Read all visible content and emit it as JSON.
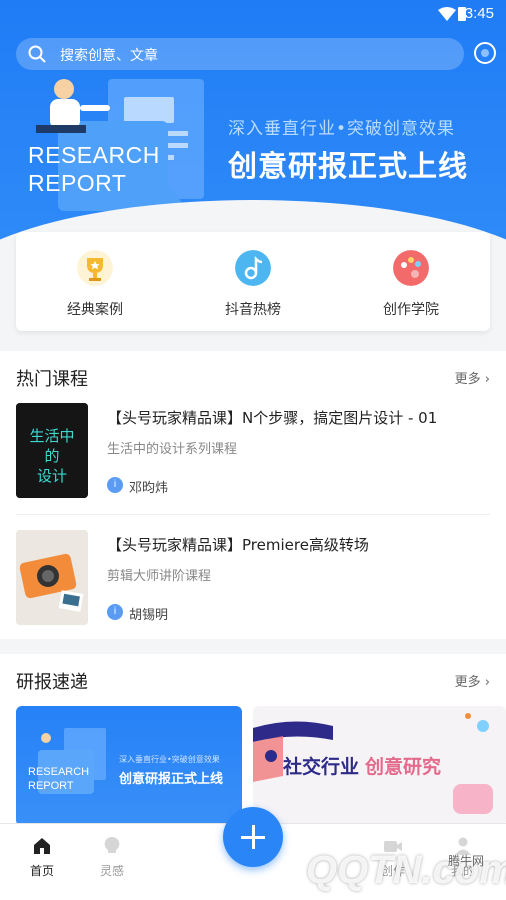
{
  "status": {
    "time": "3:45"
  },
  "search": {
    "placeholder": "搜索创意、文章"
  },
  "banner": {
    "eng_line1": "RESEARCH",
    "eng_line2": "REPORT",
    "subtitle": "深入垂直行业•突破创意效果",
    "title": "创意研报正式上线"
  },
  "quick_entries": [
    {
      "label": "经典案例",
      "icon": "trophy-icon",
      "color": "#f5b82e"
    },
    {
      "label": "抖音热榜",
      "icon": "music-note-icon",
      "color": "#4db6f0"
    },
    {
      "label": "创作学院",
      "icon": "palette-icon",
      "color": "#f26a6a"
    }
  ],
  "hot_courses": {
    "title": "热门课程",
    "more": "更多",
    "items": [
      {
        "title": "【头号玩家精品课】N个步骤，搞定图片设计 - 01",
        "subtitle": "生活中的设计系列课程",
        "author": "邓昀炜",
        "thumb_text": "生活中的设计"
      },
      {
        "title": "【头号玩家精品课】Premiere高级转场",
        "subtitle": "剪辑大师讲阶课程",
        "author": "胡锡明"
      }
    ]
  },
  "reports": {
    "title": "研报速递",
    "more": "更多",
    "cards": [
      {
        "sub": "深入垂直行业•突破创意效果",
        "title": "创意研报正式上线",
        "eng1": "RESEARCH",
        "eng2": "REPORT"
      },
      {
        "title_a": "社交行业",
        "title_b": "创意研究"
      }
    ]
  },
  "tabbar": {
    "tabs": [
      {
        "label": "首页",
        "icon": "home-icon",
        "active": true
      },
      {
        "label": "灵感",
        "icon": "lightbulb-icon",
        "active": false
      },
      {
        "label": "创作",
        "icon": "video-camera-icon",
        "active": false
      },
      {
        "label": "我的",
        "icon": "user-icon",
        "active": false
      }
    ],
    "fab_label": "+"
  },
  "watermark": {
    "logo": "QQTN.com",
    "cn": "腾牛网"
  },
  "colors": {
    "accent": "#2a86f7",
    "hero_blue": "#1f7cf5"
  }
}
